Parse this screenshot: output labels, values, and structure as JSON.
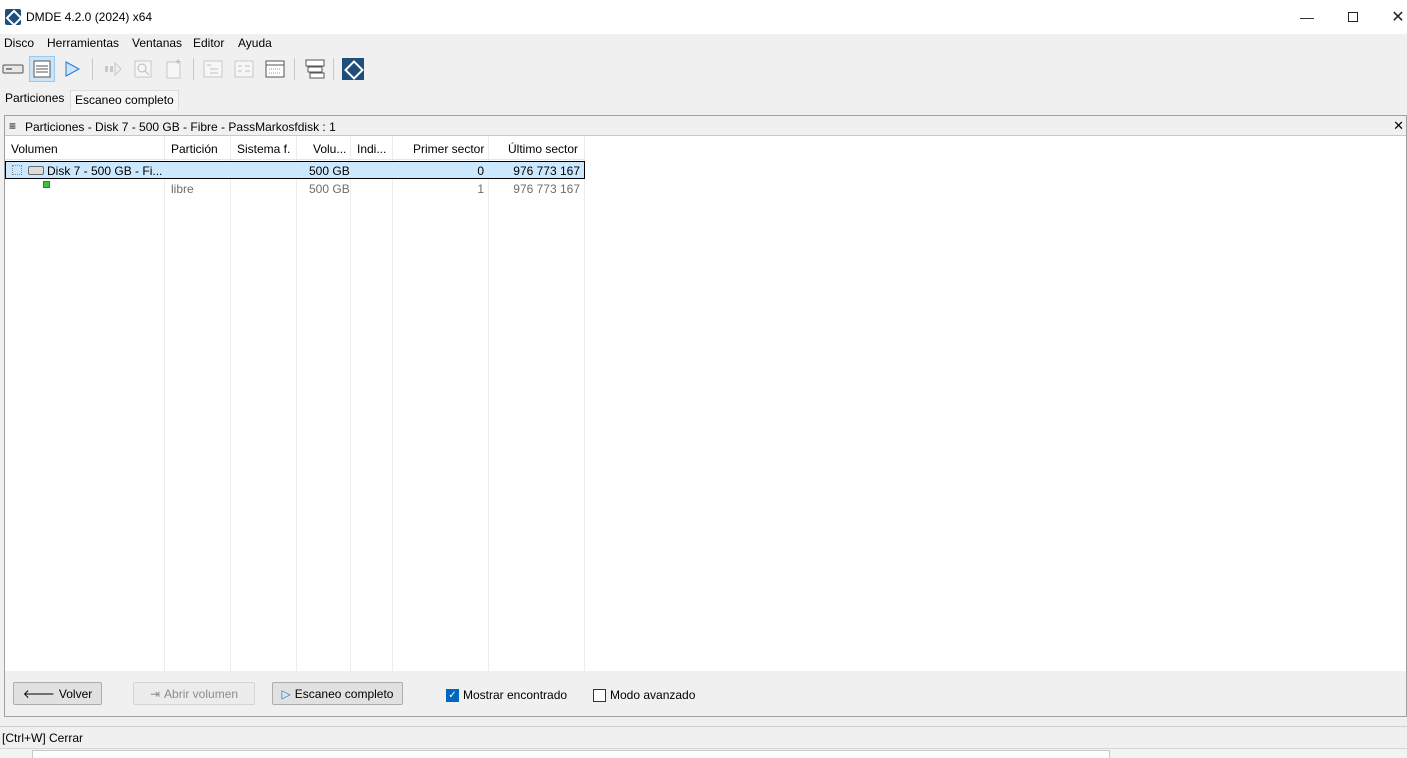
{
  "window": {
    "title": "DMDE 4.2.0 (2024) x64",
    "minimize_glyph": "—",
    "close_glyph": "✕"
  },
  "menu": [
    "Disco",
    "Herramientas",
    "Ventanas",
    "Editor",
    "Ayuda"
  ],
  "toolbar_icons": [
    "drive-icon",
    "partitions-list-icon",
    "play-icon",
    "step-icon",
    "search-icon",
    "new-file-icon",
    "tree-icon",
    "list-icon",
    "grid-icon",
    "panels-icon",
    "dmde-logo-icon"
  ],
  "tabs": [
    "Particiones",
    "Escaneo completo"
  ],
  "panel": {
    "menu_glyph": "≡",
    "title": "Particiones - Disk 7 - 500 GB - Fibre - PassMarkosfdisk : 1",
    "close_glyph": "✕"
  },
  "columns": [
    "Volumen",
    "Partición",
    "Sistema f.",
    "Volu...",
    "Indi...",
    "Primer sector",
    "Último sector"
  ],
  "rows": [
    {
      "volumen": "Disk 7 - 500 GB - Fi...",
      "particion": "",
      "sistema": "",
      "volumen_size": "500 GB",
      "indicadores": "",
      "primer": "0",
      "ultimo": "976 773 167"
    },
    {
      "volumen": "",
      "particion": "libre",
      "sistema": "",
      "volumen_size": "500 GB",
      "indicadores": "",
      "primer": "1",
      "ultimo": "976 773 167"
    }
  ],
  "buttons": {
    "back": "Volver",
    "back_glyph": "🡐",
    "open_volume": "Abrir volumen",
    "open_glyph": "⇥",
    "full_scan": "Escaneo completo",
    "scan_glyph": "▷"
  },
  "checkboxes": {
    "show_found": {
      "label": "Mostrar encontrado",
      "checked": true,
      "mark": "✓"
    },
    "advanced_mode": {
      "label": "Modo avanzado",
      "checked": false
    }
  },
  "status": "[Ctrl+W] Cerrar",
  "colors": {
    "accent": "#0067c0",
    "selection": "#cce8ff",
    "brand": "#1e4e79"
  }
}
